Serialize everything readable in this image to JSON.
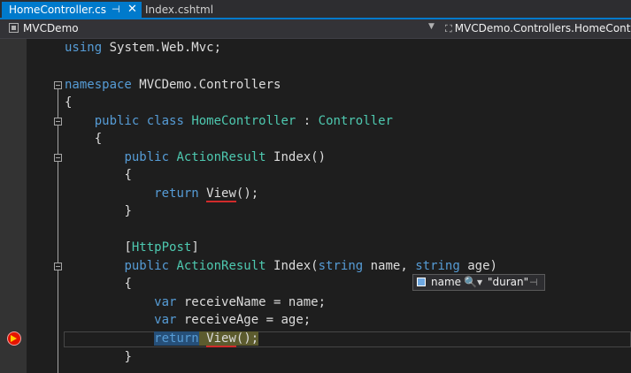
{
  "tabs": [
    {
      "label": "HomeController.cs",
      "pin": "⊣",
      "close": "✕"
    },
    {
      "label": "Index.cshtml"
    }
  ],
  "navbar": {
    "project": "MVCDemo",
    "class_path": "MVCDemo.Controllers.HomeContr"
  },
  "code": {
    "line1": {
      "kw": "using",
      "rest": " System.Web.Mvc;"
    },
    "line2": {
      "kw": "namespace",
      "rest": " MVCDemo.Controllers"
    },
    "line3": {
      "text": "{"
    },
    "line4": {
      "kw1": "public",
      "kw2": "class",
      "type1": "HomeController",
      "sep": " : ",
      "type2": "Controller"
    },
    "line5": {
      "text": "{"
    },
    "line6": {
      "kw": "public",
      "type": "ActionResult",
      "rest": " Index()"
    },
    "line7": {
      "text": "{"
    },
    "line8": {
      "kw": "return",
      "call": "View",
      "rest": "();"
    },
    "line9": {
      "text": "}"
    },
    "line10": {
      "open": "[",
      "attr": "HttpPost",
      "close": "]"
    },
    "line11": {
      "kw": "public",
      "type": "ActionResult",
      "mid": " Index(",
      "kw2": "string",
      "mid2": " name, ",
      "kw3": "string",
      "rest": " age)"
    },
    "line12": {
      "text": "{"
    },
    "line13": {
      "kw": "var",
      "rest": " receiveName = name;"
    },
    "line14": {
      "kw": "var",
      "rest": " receiveAge = age;"
    },
    "line15": {
      "kw": "return",
      "call": "View",
      "rest": "();"
    },
    "line16": {
      "text": "}"
    }
  },
  "datatip": {
    "name": "name",
    "magnifier": "🔍",
    "arrow": "▼",
    "value": "\"duran\"",
    "pin": "⊣"
  }
}
